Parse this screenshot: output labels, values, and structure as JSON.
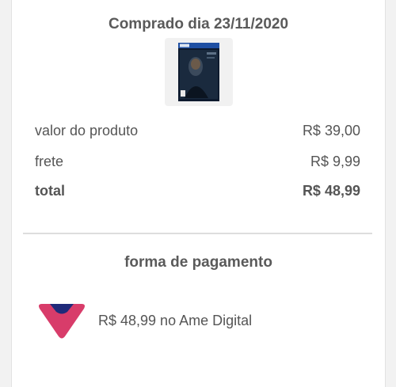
{
  "header": {
    "purchase_date": "Comprado dia 23/11/2020"
  },
  "product": {
    "image_icon": "ps4-game-cover-thumbnail"
  },
  "summary": {
    "product_label": "valor do produto",
    "product_value": "R$ 39,00",
    "shipping_label": "frete",
    "shipping_value": "R$ 9,99",
    "total_label": "total",
    "total_value": "R$ 48,99"
  },
  "payment": {
    "heading": "forma de pagamento",
    "icon": "ame-digital-logo-icon",
    "description": "R$ 48,99 no Ame Digital"
  },
  "colors": {
    "text": "#555555",
    "divider": "#dddddd",
    "ame_pink": "#d83c6a",
    "ame_navy": "#1f2a7a"
  }
}
